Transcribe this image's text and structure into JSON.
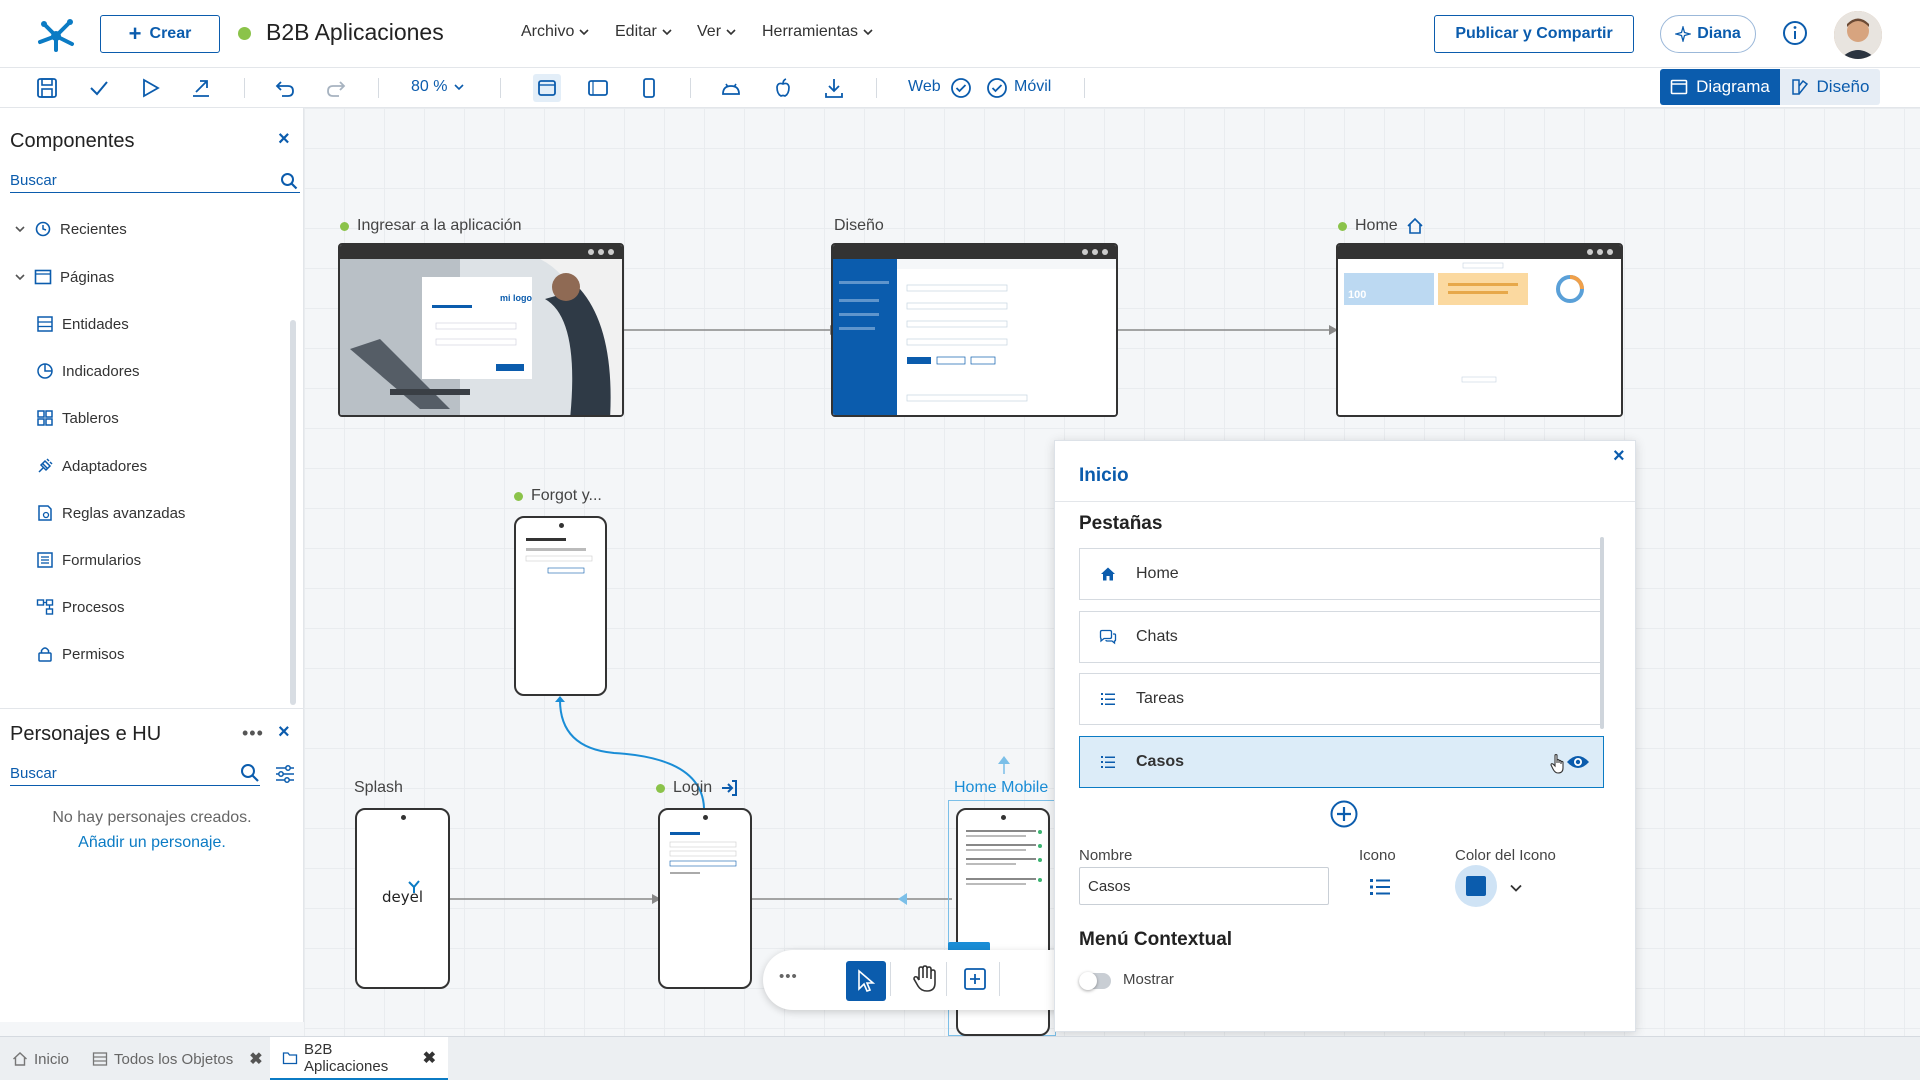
{
  "header": {
    "crear_label": "Crear",
    "app_title": "B2B Aplicaciones",
    "menus": [
      "Archivo",
      "Editar",
      "Ver",
      "Herramientas"
    ],
    "publicar_label": "Publicar y Compartir",
    "diana_label": "Diana"
  },
  "toolbar": {
    "zoom": "80 %",
    "web_label": "Web",
    "movil_label": "Móvil",
    "diagrama_label": "Diagrama",
    "diseno_label": "Diseño"
  },
  "components_panel": {
    "title": "Componentes",
    "search_placeholder": "Buscar",
    "items": [
      "Recientes",
      "Páginas",
      "Entidades",
      "Indicadores",
      "Tableros",
      "Adaptadores",
      "Reglas avanzadas",
      "Formularios",
      "Procesos",
      "Permisos"
    ]
  },
  "personas_panel": {
    "title": "Personajes e HU",
    "search_placeholder": "Buscar",
    "empty_text": "No hay personajes creados.",
    "add_link": "Añadir un personaje."
  },
  "canvas": {
    "nodes": {
      "ingresar": "Ingresar a la aplicación",
      "diseno": "Diseño",
      "home": "Home",
      "forgot": "Forgot y...",
      "splash": "Splash",
      "login": "Login",
      "home_mobile": "Home Mobile"
    },
    "home_thumb_value": "100",
    "login_thumb_logo": "mi logo",
    "splash_thumb_logo": "deyel"
  },
  "inicio_panel": {
    "title": "Inicio",
    "tabs_title": "Pestañas",
    "tabs": [
      "Home",
      "Chats",
      "Tareas",
      "Casos"
    ],
    "selected_tab": "Casos",
    "nombre_label": "Nombre",
    "nombre_value": "Casos",
    "icono_label": "Icono",
    "color_label": "Color del Icono",
    "icon_color": "#0b5cad",
    "menu_title": "Menú Contextual",
    "mostrar_label": "Mostrar"
  },
  "bottom_tabs": [
    "Inicio",
    "Todos los Objetos",
    "B2B Aplicaciones"
  ]
}
